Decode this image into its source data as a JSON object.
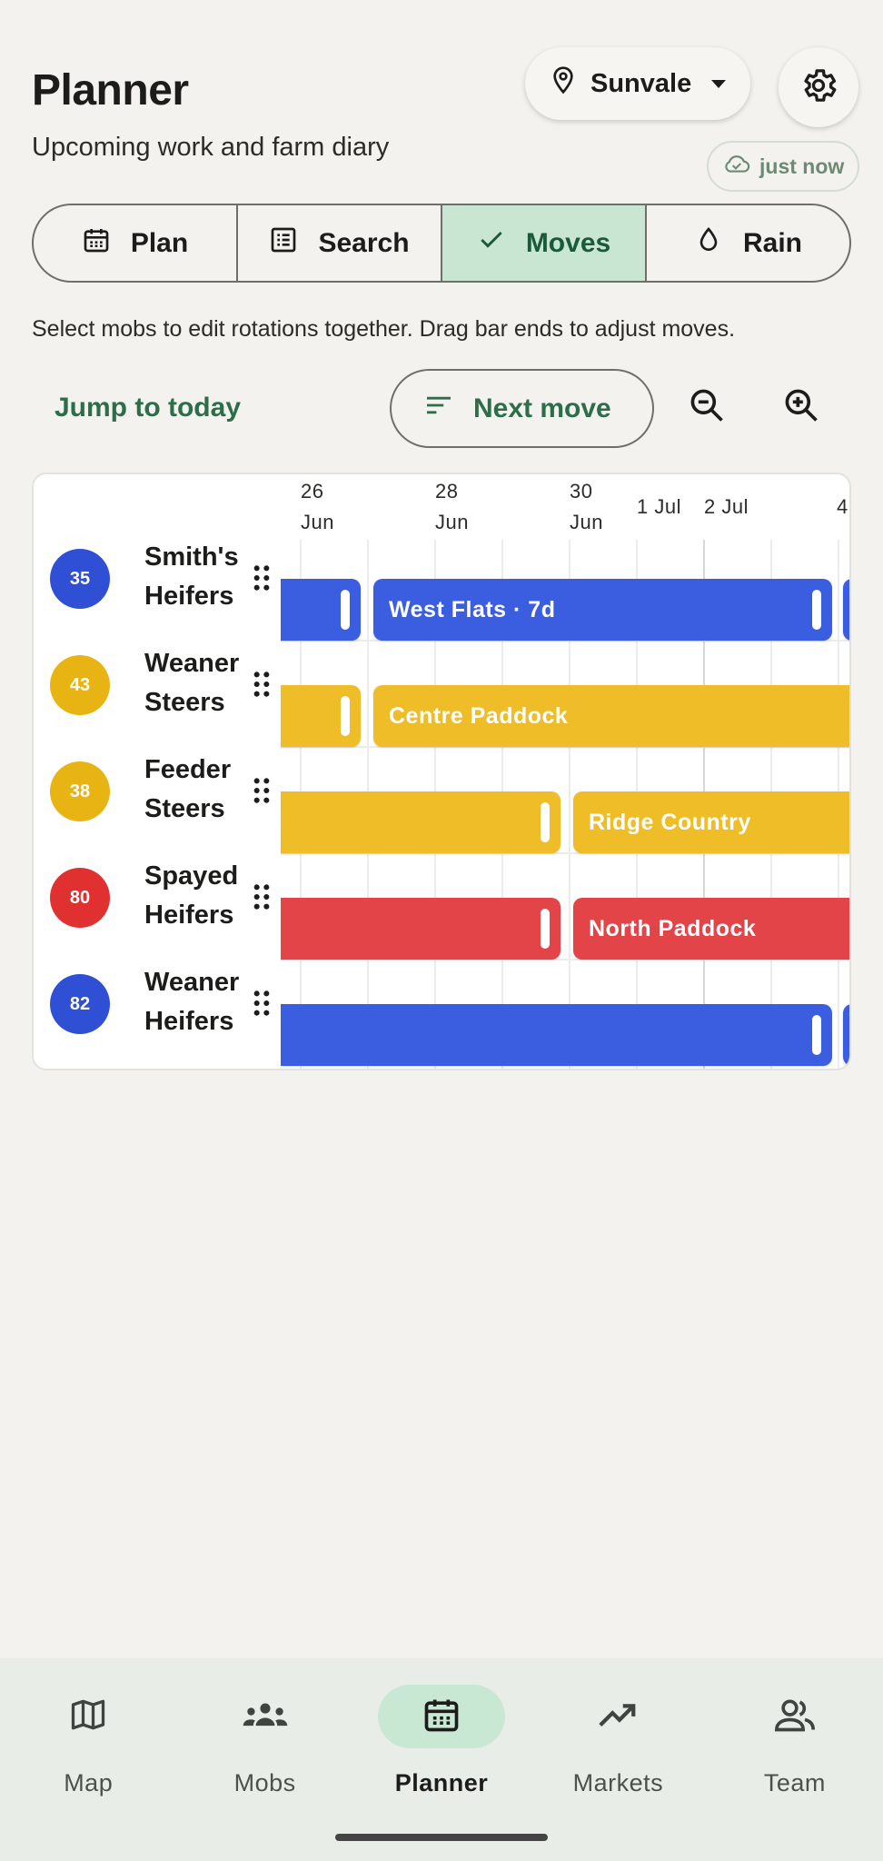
{
  "header": {
    "title": "Planner",
    "subtitle": "Upcoming work and farm diary",
    "location": "Sunvale",
    "sync_status": "just now"
  },
  "tabs": [
    {
      "label": "Plan",
      "icon": "calendar-icon",
      "active": false
    },
    {
      "label": "Search",
      "icon": "list-icon",
      "active": false
    },
    {
      "label": "Moves",
      "icon": "check-icon",
      "active": true
    },
    {
      "label": "Rain",
      "icon": "drop-icon",
      "active": false
    }
  ],
  "hint": "Select mobs to edit rotations together. Drag bar ends to adjust moves.",
  "toolbar": {
    "jump_label": "Jump to today",
    "next_move_label": "Next move"
  },
  "timeline": {
    "ticks": [
      "26\nJun",
      "28\nJun",
      "30\nJun",
      "1 Jul",
      "2 Jul",
      "4"
    ],
    "mobs": [
      {
        "count": "35",
        "name": "Smith's Heifers",
        "color": "#2f4fd4",
        "bars": [
          {
            "label": ""
          },
          {
            "label": "West Flats · 7d"
          },
          {
            "label": ""
          }
        ]
      },
      {
        "count": "43",
        "name": "Weaner Steers",
        "color": "#e8b414",
        "bars": [
          {
            "label": ""
          },
          {
            "label": "Centre Paddock"
          }
        ]
      },
      {
        "count": "38",
        "name": "Feeder Steers",
        "color": "#e8b414",
        "bars": [
          {
            "label": ""
          },
          {
            "label": "Ridge Country"
          }
        ]
      },
      {
        "count": "80",
        "name": "Spayed Heifers",
        "color": "#e0302f",
        "bars": [
          {
            "label": ""
          },
          {
            "label": "North Paddock"
          }
        ]
      },
      {
        "count": "82",
        "name": "Weaner Heifers",
        "color": "#2f4fd4",
        "bars": [
          {
            "label": ""
          },
          {
            "label": ""
          }
        ]
      }
    ],
    "bar_colors": {
      "blue": "#3b5ee0",
      "yellow": "#eebd28",
      "red": "#e24448"
    }
  },
  "bottom_nav": [
    {
      "label": "Map",
      "icon": "map-icon",
      "active": false
    },
    {
      "label": "Mobs",
      "icon": "group-icon",
      "active": false
    },
    {
      "label": "Planner",
      "icon": "calendar-icon",
      "active": true
    },
    {
      "label": "Markets",
      "icon": "trending-up-icon",
      "active": false
    },
    {
      "label": "Team",
      "icon": "people-icon",
      "active": false
    }
  ]
}
